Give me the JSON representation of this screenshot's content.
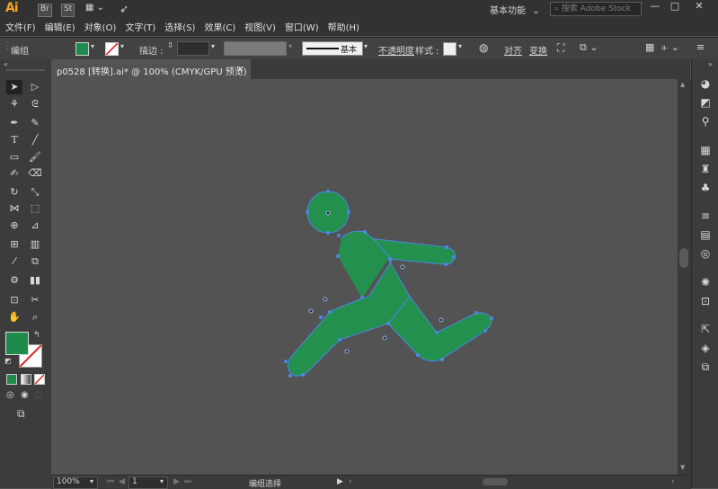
{
  "app": {
    "logo": "Ai",
    "bridge_badge": "Br",
    "stock_badge": "St",
    "workspace": "基本功能",
    "search_placeholder": "搜索 Adobe Stock"
  },
  "menu": [
    "文件(F)",
    "编辑(E)",
    "对象(O)",
    "文字(T)",
    "选择(S)",
    "效果(C)",
    "视图(V)",
    "窗口(W)",
    "帮助(H)"
  ],
  "window_controls": {
    "minimize": "—",
    "maximize": "□",
    "close": "✕"
  },
  "control_bar": {
    "mode_label": "编组",
    "stroke_label": "描边 :",
    "stroke_style": "基本",
    "opacity_label": "不透明度",
    "style_label": "样式 :",
    "align_label": "对齐",
    "transform_label": "变换",
    "fill_color": "#1e8a4c"
  },
  "document": {
    "tab_title": "p0528 [转换].ai* @ 100% (CMYK/GPU 预览)",
    "close_glyph": "×"
  },
  "artwork": {
    "figure_color": "#23904e",
    "path_color": "#4a89e8"
  },
  "status_bar": {
    "zoom": "100%",
    "page": "1",
    "tool_name": "编组选择"
  }
}
